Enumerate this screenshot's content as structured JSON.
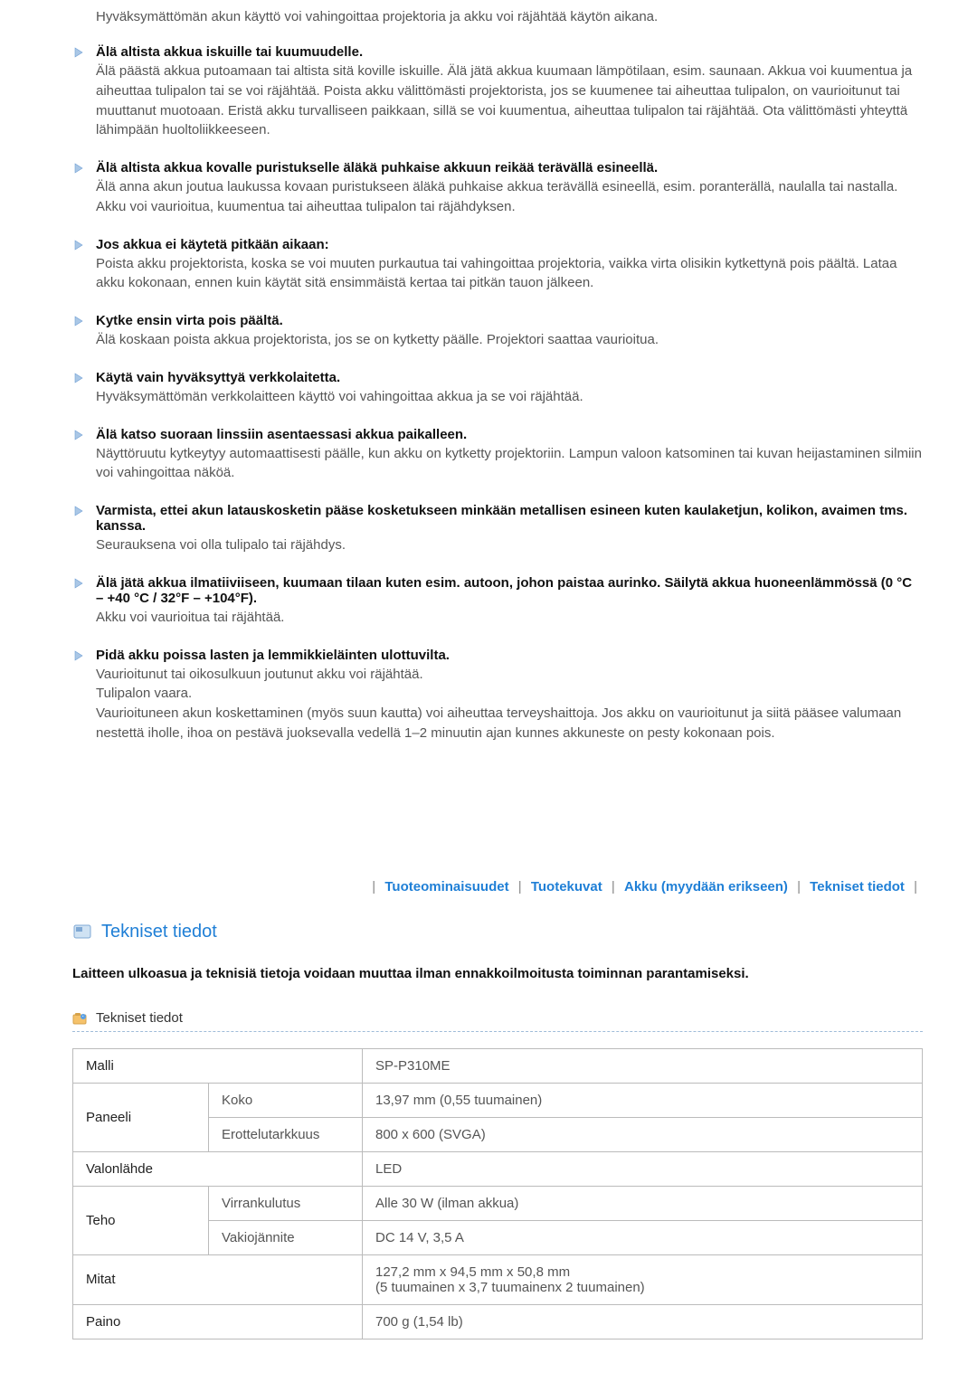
{
  "intro": "Hyväksymättömän akun käyttö voi vahingoittaa projektoria ja akku voi räjähtää käytön aikana.",
  "warnings": [
    {
      "title": "Älä altista akkua iskuille tai kuumuudelle.",
      "body": "Älä päästä akkua putoamaan tai altista sitä koville iskuille. Älä jätä akkua kuumaan lämpötilaan, esim. saunaan. Akkua voi kuumentua ja aiheuttaa tulipalon tai se voi räjähtää. Poista akku välittömästi projektorista, jos se kuumenee tai aiheuttaa tulipalon, on vaurioitunut tai muuttanut muotoaan. Eristä akku turvalliseen paikkaan, sillä se voi kuumentua, aiheuttaa tulipalon tai räjähtää. Ota välittömästi yhteyttä lähimpään huoltoliikkeeseen."
    },
    {
      "title": "Älä altista akkua kovalle puristukselle äläkä puhkaise akkuun reikää terävällä esineellä.",
      "body": "Älä anna akun joutua laukussa kovaan puristukseen äläkä puhkaise akkua terävällä esineellä, esim. poranterällä, naulalla tai nastalla. Akku voi vaurioitua, kuumentua tai aiheuttaa tulipalon tai räjähdyksen."
    },
    {
      "title": "Jos akkua ei käytetä pitkään aikaan:",
      "body": "Poista akku projektorista, koska se voi muuten purkautua tai vahingoittaa projektoria, vaikka virta olisikin kytkettynä pois päältä. Lataa akku kokonaan, ennen kuin käytät sitä ensimmäistä kertaa tai pitkän tauon jälkeen."
    },
    {
      "title": "Kytke ensin virta pois päältä.",
      "body": "Älä koskaan poista akkua projektorista, jos se on kytketty päälle. Projektori saattaa vaurioitua."
    },
    {
      "title": "Käytä vain hyväksyttyä verkkolaitetta.",
      "body": "Hyväksymättömän verkkolaitteen käyttö voi vahingoittaa akkua ja se voi räjähtää."
    },
    {
      "title": "Älä katso suoraan linssiin asentaessasi akkua paikalleen.",
      "body": "Näyttöruutu kytkeytyy automaattisesti päälle, kun akku on kytketty projektoriin. Lampun valoon katsominen tai kuvan heijastaminen silmiin voi vahingoittaa näköä."
    },
    {
      "title": "Varmista, ettei akun latauskosketin pääse kosketukseen minkään metallisen esineen kuten kaulaketjun, kolikon, avaimen tms. kanssa.",
      "body": "Seurauksena voi olla tulipalo tai räjähdys."
    },
    {
      "title": "Älä jätä akkua ilmatiiviiseen, kuumaan tilaan kuten esim. autoon, johon paistaa aurinko. Säilytä akkua huoneenlämmössä (0 °C – +40 °C / 32°F – +104°F).",
      "body": "Akku voi vaurioitua tai räjähtää."
    },
    {
      "title": "Pidä akku poissa lasten ja lemmikkieläinten ulottuvilta.",
      "body": "Vaurioitunut tai oikosulkuun joutunut akku voi räjähtää.\nTulipalon vaara.\nVaurioituneen akun koskettaminen (myös suun kautta) voi aiheuttaa terveyshaittoja. Jos akku on vaurioitunut ja siitä pääsee valumaan nestettä iholle, ihoa on pestävä juoksevalla vedellä 1–2 minuutin ajan kunnes akkuneste on pesty kokonaan pois."
    }
  ],
  "nav": {
    "a": "Tuoteominaisuudet",
    "b": "Tuotekuvat",
    "c": "Akku (myydään erikseen)",
    "d": "Tekniset tiedot"
  },
  "section_heading": "Tekniset tiedot",
  "section_note": "Laitteen ulkoasua ja teknisiä tietoja voidaan muuttaa ilman ennakkoilmoitusta toiminnan parantamiseksi.",
  "subsection": "Tekniset tiedot",
  "spec": {
    "model_label": "Malli",
    "model_value": "SP-P310ME",
    "panel_label": "Paneeli",
    "panel_size_label": "Koko",
    "panel_size_value": "13,97 mm (0,55 tuumainen)",
    "panel_res_label": "Erottelutarkkuus",
    "panel_res_value": "800 x 600 (SVGA)",
    "light_label": "Valonlähde",
    "light_value": "LED",
    "power_label": "Teho",
    "power_cons_label": "Virrankulutus",
    "power_cons_value": "Alle 30 W (ilman akkua)",
    "power_volt_label": "Vakiojännite",
    "power_volt_value": "DC 14 V, 3,5 A",
    "dim_label": "Mitat",
    "dim_value": "127,2 mm x 94,5 mm x 50,8 mm\n(5 tuumainen x 3,7 tuumainenx 2 tuumainen)",
    "weight_label": "Paino",
    "weight_value": "700 g (1,54 lb)"
  }
}
